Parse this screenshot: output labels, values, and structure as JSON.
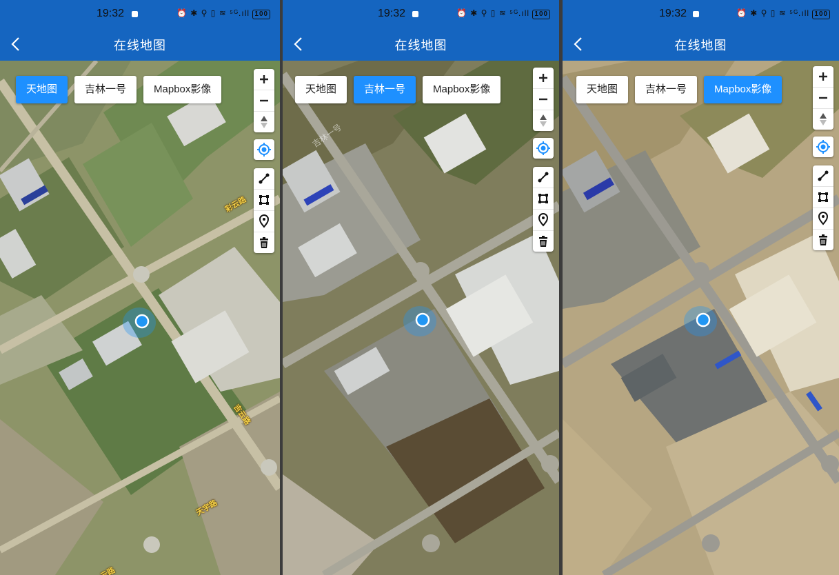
{
  "panels": [
    {
      "status_time": "19:32",
      "status_icons": "⏰ ✱ ⚲ ▯ ≋ ⁵ᴳ.ıll",
      "battery": "100",
      "title": "在线地图",
      "tabs": [
        {
          "label": "天地图",
          "active": true
        },
        {
          "label": "吉林一号",
          "active": false
        },
        {
          "label": "Mapbox影像",
          "active": false
        }
      ],
      "road_labels": [
        "彩云路",
        "吉云路",
        "天宇路",
        "云路"
      ],
      "watermark": "",
      "palette": {
        "base": "#8d9468",
        "field": "#66834e",
        "road": "#c7c0a5",
        "building": "#d8d8d4"
      }
    },
    {
      "status_time": "19:32",
      "status_icons": "⏰ ✱ ⚲ ▯ ≋ ⁵ᴳ.ıll",
      "battery": "100",
      "title": "在线地图",
      "tabs": [
        {
          "label": "天地图",
          "active": false
        },
        {
          "label": "吉林一号",
          "active": true
        },
        {
          "label": "Mapbox影像",
          "active": false
        }
      ],
      "road_labels": [],
      "watermark": "吉林一号",
      "palette": {
        "base": "#7f7d5c",
        "field": "#5f6b40",
        "road": "#a9a79a",
        "building": "#e2e3e0"
      }
    },
    {
      "status_time": "19:32",
      "status_icons": "⏰ ✱ ⚲ ▯ ≋ ⁵ᴳ.ıll",
      "battery": "100",
      "title": "在线地图",
      "tabs": [
        {
          "label": "天地图",
          "active": false
        },
        {
          "label": "吉林一号",
          "active": false
        },
        {
          "label": "Mapbox影像",
          "active": true
        }
      ],
      "road_labels": [],
      "watermark": "",
      "palette": {
        "base": "#b6a682",
        "field": "#8d8a5a",
        "road": "#9c9a92",
        "building": "#e6e2d6"
      }
    }
  ],
  "zoom_controls": [
    "zoom-in-icon",
    "zoom-out-icon",
    "compass-icon"
  ],
  "locate_control": "crosshair-icon",
  "draw_tools": [
    "draw-line-icon",
    "draw-polygon-icon",
    "draw-point-icon",
    "trash-icon"
  ],
  "colors": {
    "appbar": "#1565c0",
    "active_tab": "#1e90ff",
    "location": "#2196f3"
  }
}
